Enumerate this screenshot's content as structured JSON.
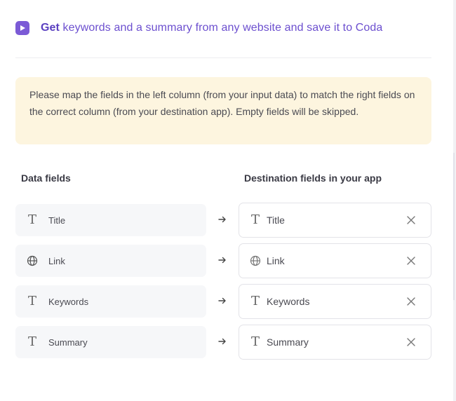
{
  "header": {
    "icon": "play-icon",
    "title_bold": "Get",
    "title_rest": " keywords and a summary from any website and save it to Coda"
  },
  "notice": {
    "text": "Please map the fields in the left column (from your input data) to match the right fields on the correct column (from your destination app). Empty fields will be skipped."
  },
  "columns": {
    "data_fields": "Data fields",
    "destination_fields": "Destination fields in your app"
  },
  "mappings": [
    {
      "source": "Title",
      "source_icon": "text-type-icon",
      "destination": "Title",
      "destination_icon": "text-type-icon"
    },
    {
      "source": "Link",
      "source_icon": "globe-icon",
      "destination": "Link",
      "destination_icon": "globe-icon"
    },
    {
      "source": "Keywords",
      "source_icon": "text-type-icon",
      "destination": "Keywords",
      "destination_icon": "text-type-icon"
    },
    {
      "source": "Summary",
      "source_icon": "text-type-icon",
      "destination": "Summary",
      "destination_icon": "text-type-icon"
    }
  ],
  "colors": {
    "accent": "#7b5ad6",
    "notice_bg": "#fdf5df"
  }
}
